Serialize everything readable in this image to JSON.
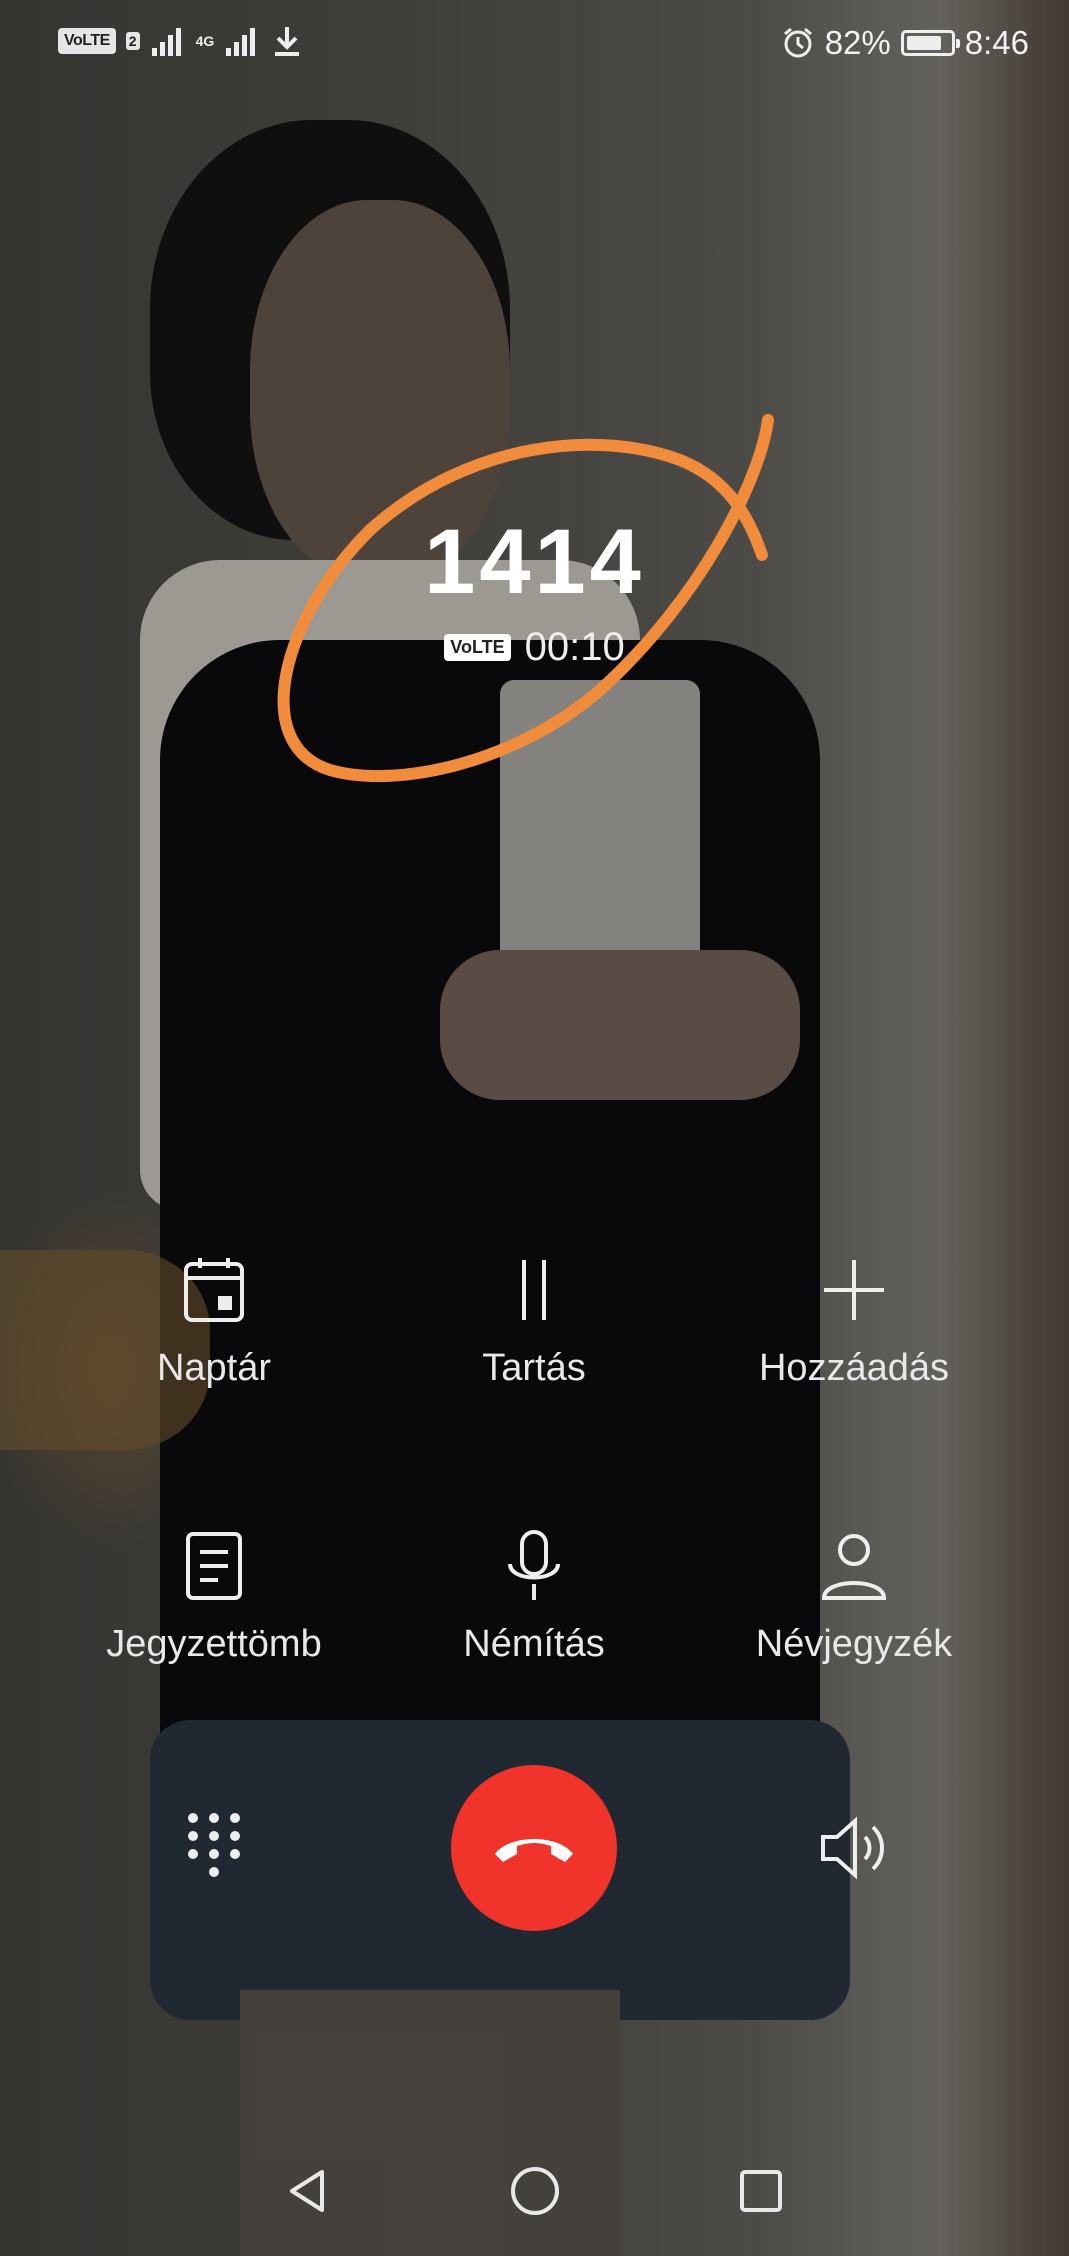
{
  "status_bar": {
    "left_badge": "VoLTE",
    "sim_number": "2",
    "network": "4G",
    "battery_percent": "82%",
    "battery_level": 0.82,
    "time": "8:46",
    "icons": [
      "volte-icon",
      "signal-icon",
      "4g-signal-icon",
      "download-icon",
      "alarm-icon",
      "battery-icon"
    ]
  },
  "call": {
    "number": "1414",
    "badge": "VoLTE",
    "duration": "00:10"
  },
  "actions": [
    {
      "label": "Naptár",
      "icon": "calendar-icon"
    },
    {
      "label": "Tartás",
      "icon": "pause-icon"
    },
    {
      "label": "Hozzáadás",
      "icon": "plus-icon"
    },
    {
      "label": "Jegyzettömb",
      "icon": "notepad-icon"
    },
    {
      "label": "Némítás",
      "icon": "microphone-icon"
    },
    {
      "label": "Névjegyzék",
      "icon": "contact-icon"
    }
  ],
  "controls": {
    "dialpad_icon": "dialpad-icon",
    "hangup_icon": "end-call-icon",
    "speaker_icon": "speaker-icon",
    "hangup_color": "#f0332b"
  },
  "nav": {
    "back": "back-icon",
    "home": "home-icon",
    "recents": "recents-icon"
  },
  "annotation_color": "#f08c3c"
}
